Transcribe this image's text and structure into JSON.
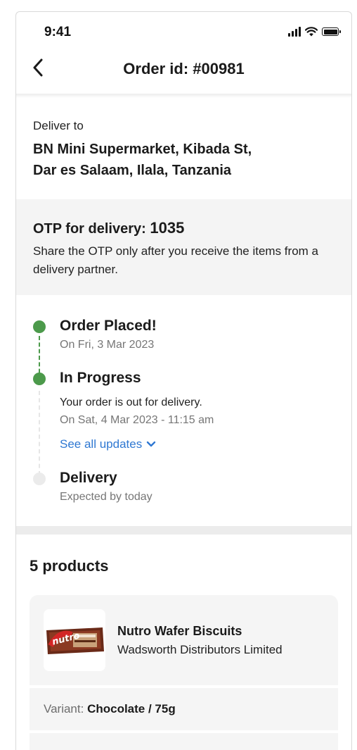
{
  "status_bar": {
    "time": "9:41"
  },
  "header": {
    "title": "Order id: #00981"
  },
  "delivery": {
    "label": "Deliver to",
    "address_line1": "BN Mini Supermarket, Kibada St,",
    "address_line2": "Dar es Salaam, Ilala, Tanzania"
  },
  "otp": {
    "label": "OTP for delivery: ",
    "code": "1035",
    "note": "Share the OTP only after you receive the items from a delivery partner."
  },
  "timeline": {
    "steps": [
      {
        "title": "Order Placed!",
        "subtitle": "On Fri, 3 Mar 2023",
        "status": "done"
      },
      {
        "title": "In Progress",
        "message": "Your order is out for delivery.",
        "subtitle": "On Sat, 4 Mar 2023 - 11:15 am",
        "status": "done"
      },
      {
        "title": "Delivery",
        "subtitle": "Expected by today",
        "status": "pending"
      }
    ],
    "see_all_label": "See all updates"
  },
  "products": {
    "count_label": "5 products",
    "items": [
      {
        "name": "Nutro Wafer Biscuits",
        "seller": "Wadsworth Distributors Limited",
        "variant_label": "Variant: ",
        "variant_value": "Chocolate / 75g",
        "brand_mark": "nutro"
      }
    ]
  },
  "colors": {
    "accent_green": "#4c9a4b",
    "link_blue": "#2f78d2",
    "muted_grey": "#767676",
    "panel_grey": "#f4f4f4"
  }
}
